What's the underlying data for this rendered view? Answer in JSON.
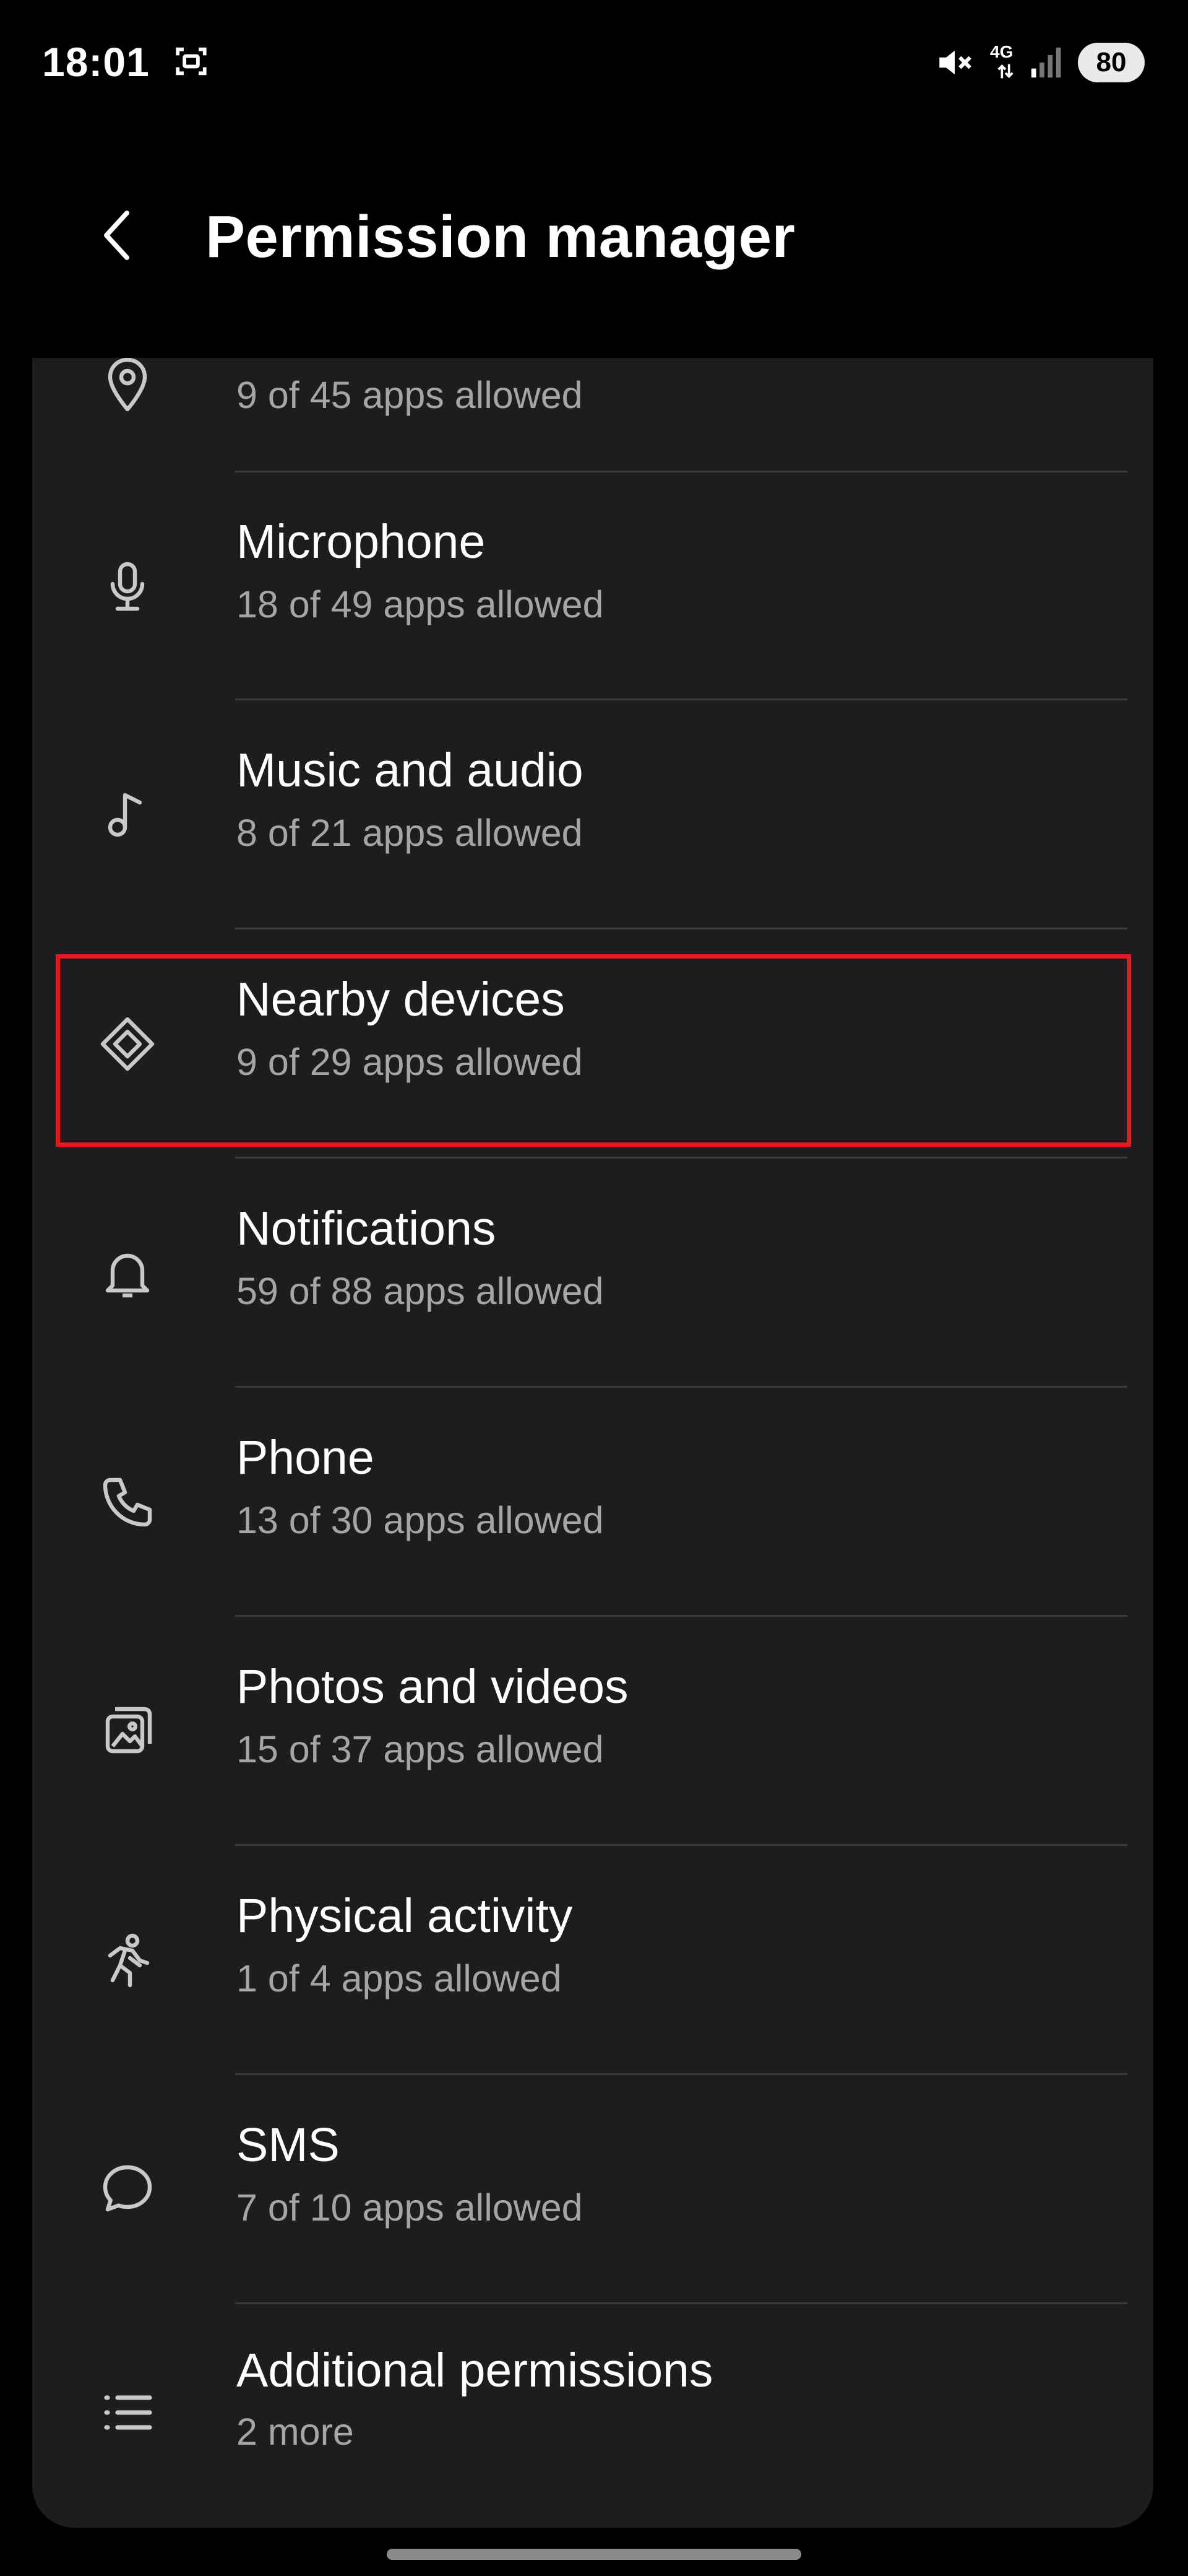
{
  "status_bar": {
    "time": "18:01",
    "network_label": "4G",
    "battery": "80",
    "icons": [
      "screenshot-icon",
      "mute-icon",
      "network-4g-icon",
      "signal-icon"
    ]
  },
  "header": {
    "title": "Permission manager",
    "back_icon": "back-chevron-icon"
  },
  "permissions": [
    {
      "title": "",
      "subtitle": "9 of 45 apps allowed",
      "icon": "location-icon"
    },
    {
      "title": "Microphone",
      "subtitle": "18 of 49 apps allowed",
      "icon": "microphone-icon"
    },
    {
      "title": "Music and audio",
      "subtitle": "8 of 21 apps allowed",
      "icon": "music-note-icon"
    },
    {
      "title": "Nearby devices",
      "subtitle": "9 of 29 apps allowed",
      "icon": "nearby-devices-icon"
    },
    {
      "title": "Notifications",
      "subtitle": "59 of 88 apps allowed",
      "icon": "bell-icon"
    },
    {
      "title": "Phone",
      "subtitle": "13 of 30 apps allowed",
      "icon": "phone-icon"
    },
    {
      "title": "Photos and videos",
      "subtitle": "15 of 37 apps allowed",
      "icon": "photos-icon"
    },
    {
      "title": "Physical activity",
      "subtitle": "1 of 4 apps allowed",
      "icon": "activity-icon"
    },
    {
      "title": "SMS",
      "subtitle": "7 of 10 apps allowed",
      "icon": "sms-icon"
    },
    {
      "title": "Additional permissions",
      "subtitle": "2 more",
      "icon": "list-icon"
    }
  ],
  "colors": {
    "background": "#000000",
    "card": "#1d1d1f",
    "subtitle": "#a5a5a8",
    "highlight": "#e11a1a"
  }
}
